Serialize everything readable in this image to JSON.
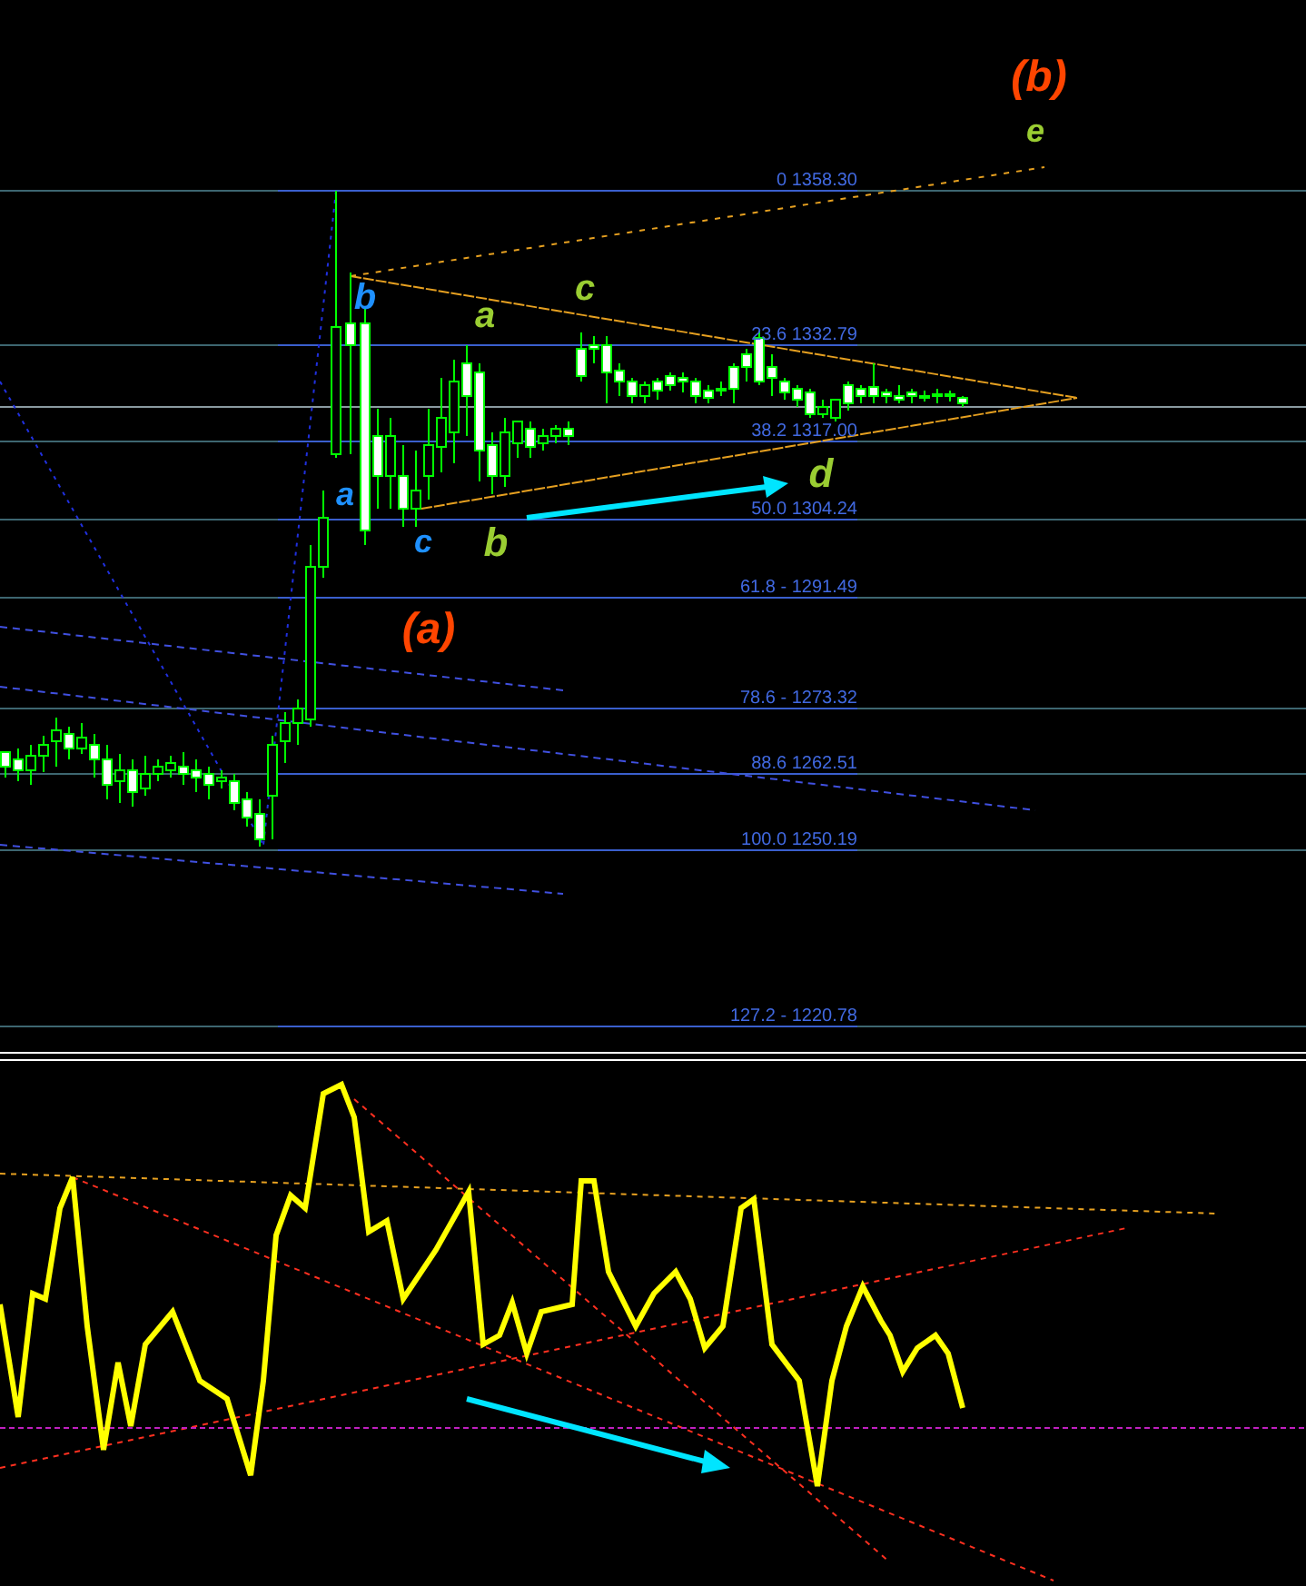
{
  "price_chart": {
    "fib_levels": [
      {
        "label": "0 1358.30"
      },
      {
        "label": "23.6 1332.79"
      },
      {
        "label": "38.2 1317.00"
      },
      {
        "label": "50.0 1304.24"
      },
      {
        "label": "61.8 - 1291.49"
      },
      {
        "label": "78.6 - 1273.32"
      },
      {
        "label": "88.6 1262.51"
      },
      {
        "label": "100.0 1250.19"
      },
      {
        "label": "127.2 - 1220.78"
      }
    ],
    "wave_labels": [
      {
        "text": "(b)",
        "color": "#ff4500"
      },
      {
        "text": "e",
        "color": "#9acd32"
      },
      {
        "text": "b",
        "color": "#1e90ff"
      },
      {
        "text": "a",
        "color": "#9acd32"
      },
      {
        "text": "c",
        "color": "#9acd32"
      },
      {
        "text": "a",
        "color": "#1e90ff"
      },
      {
        "text": "c",
        "color": "#1e90ff"
      },
      {
        "text": "b",
        "color": "#9acd32"
      },
      {
        "text": "(a)",
        "color": "#ff4500"
      },
      {
        "text": "d",
        "color": "#9acd32"
      }
    ]
  }
}
